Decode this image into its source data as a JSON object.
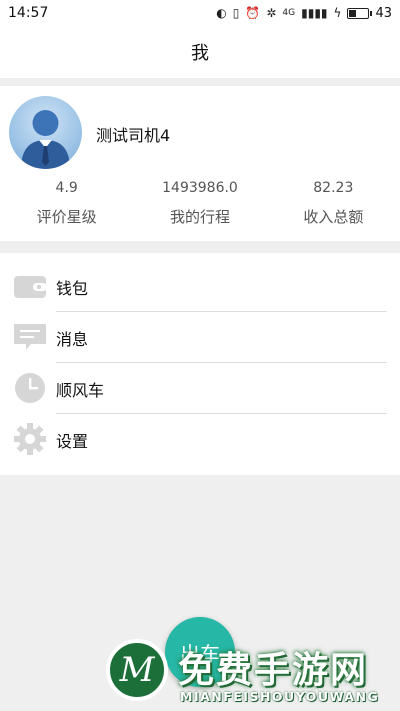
{
  "status_bar": {
    "time": "14:57",
    "network_label": "4G",
    "battery_level": "43",
    "battery_fraction": 0.43
  },
  "header": {
    "title": "我"
  },
  "profile": {
    "name": "测试司机4",
    "stats": [
      {
        "value": "4.9",
        "label": "评价星级"
      },
      {
        "value": "1493986.0",
        "label": "我的行程"
      },
      {
        "value": "82.23",
        "label": "收入总额"
      }
    ]
  },
  "menu": {
    "items": [
      {
        "label": "钱包",
        "icon": "wallet-icon"
      },
      {
        "label": "消息",
        "icon": "message-icon"
      },
      {
        "label": "顺风车",
        "icon": "clock-icon"
      },
      {
        "label": "设置",
        "icon": "gear-icon"
      }
    ]
  },
  "fab": {
    "label": "出车"
  },
  "watermark": {
    "logo_letter": "M",
    "title": "免费手游网",
    "subtitle": "MIANFEISHOUYOUWANG"
  },
  "colors": {
    "accent": "#26b7a6",
    "background": "#efefef",
    "icon_gray": "#d6d6d6"
  }
}
